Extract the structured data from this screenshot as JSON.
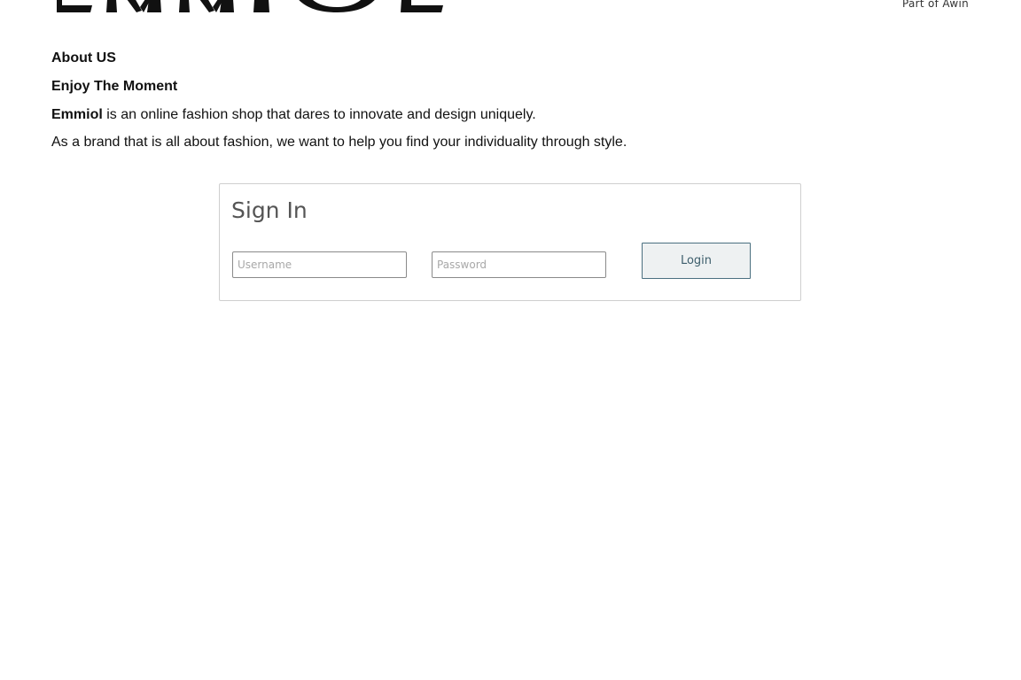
{
  "header": {
    "brand": "EMMIOL",
    "partner_text": "Part of Awin"
  },
  "about": {
    "heading": "About US",
    "subheading": "Enjoy The Moment",
    "brand_name": "Emmiol",
    "line1_rest": " is an online fashion shop that dares to innovate and design uniquely.",
    "line2": "As a brand that is all about fashion, we want to help you find your individuality through style."
  },
  "signin": {
    "title": "Sign In",
    "username_placeholder": "Username",
    "username_value": "",
    "password_placeholder": "Password",
    "password_value": "",
    "login_label": "Login"
  },
  "colors": {
    "login_border": "#4a6f80",
    "login_bg": "#eef1f2",
    "box_border": "#cfcfcf"
  }
}
